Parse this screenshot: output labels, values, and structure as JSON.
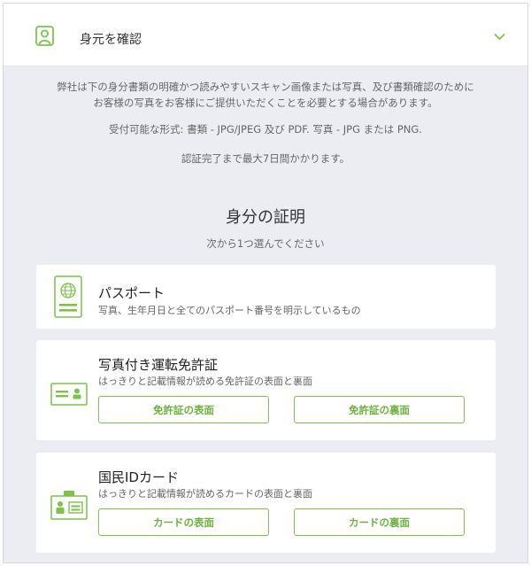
{
  "header": {
    "title": "身元を確認",
    "icons": {
      "person": "person-outline-icon",
      "expand": "chevron-down-icon"
    }
  },
  "info": {
    "line1": "弊社は下の身分書類の明確かつ読みやすいスキャン画像または写真、及び書類確認のために",
    "line2": "お客様の写真をお客様にご提供いただくことを必要とする場合があります。",
    "formats": "受付可能な形式: 書類 - JPG/JPEG 及び PDF. 写真 - JPG または PNG.",
    "duration": "認証完了まで最大7日間かかります。"
  },
  "section": {
    "title": "身分の証明",
    "subtitle": "次から1つ選んでください"
  },
  "documents": [
    {
      "title": "パスポート",
      "description": "写真、生年月日と全てのパスポート番号を明示しているもの",
      "icon": "passport-icon"
    },
    {
      "title": "写真付き運転免許証",
      "description": "はっきりと記載情報が読める免許証の表面と裏面",
      "icon": "drivers-license-icon",
      "buttons": [
        "免許証の表面",
        "免許証の裏面"
      ]
    },
    {
      "title": "国民IDカード",
      "description": "はっきりと記載情報が読めるカードの表面と裏面",
      "icon": "id-card-icon",
      "buttons": [
        "カードの表面",
        "カードの裏面"
      ]
    }
  ],
  "colors": {
    "accent": "#7fc24a",
    "background": "#ecedf2"
  }
}
